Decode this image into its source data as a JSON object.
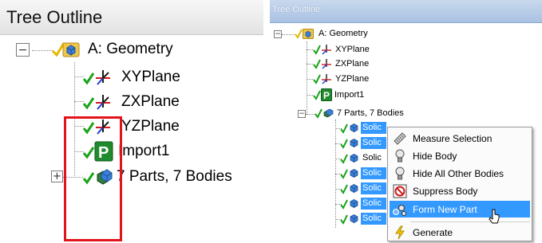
{
  "left_panel": {
    "header": "Tree Outline",
    "root": {
      "label": "A: Geometry",
      "expander": "−"
    },
    "items": [
      {
        "label": "XYPlane"
      },
      {
        "label": "ZXPlane"
      },
      {
        "label": "YZPlane"
      },
      {
        "label": "Import1"
      },
      {
        "label": "7 Parts, 7 Bodies",
        "expander": "+"
      }
    ]
  },
  "right_panel": {
    "header": "Tree Outline",
    "root": {
      "label": "A: Geometry",
      "expander": "−"
    },
    "items": [
      {
        "label": "XYPlane"
      },
      {
        "label": "ZXPlane"
      },
      {
        "label": "YZPlane"
      },
      {
        "label": "Import1"
      },
      {
        "label": "7 Parts, 7 Bodies",
        "expander": "−"
      }
    ],
    "solids": [
      {
        "label": "Solic",
        "selected": true
      },
      {
        "label": "Solic",
        "selected": true
      },
      {
        "label": "Solic",
        "selected": false
      },
      {
        "label": "Solic",
        "selected": true
      },
      {
        "label": "Solic",
        "selected": true
      },
      {
        "label": "Solic",
        "selected": true
      },
      {
        "label": "Solic",
        "selected": true
      }
    ]
  },
  "context_menu": {
    "items": [
      {
        "label": "Measure Selection",
        "icon": "ruler-icon"
      },
      {
        "label": "Hide Body",
        "icon": "lightbulb-icon"
      },
      {
        "label": "Hide All Other Bodies",
        "icon": "lightbulb-icon"
      },
      {
        "label": "Suppress Body",
        "icon": "suppress-icon"
      },
      {
        "label": "Form New Part",
        "icon": "form-part-icon",
        "active": true
      },
      {
        "label": "Generate",
        "icon": "lightning-icon"
      }
    ]
  },
  "colors": {
    "selection": "#3399ff",
    "highlight_box": "#e3131b",
    "check_green": "#1aa31a",
    "check_yellow": "#e6b800"
  }
}
